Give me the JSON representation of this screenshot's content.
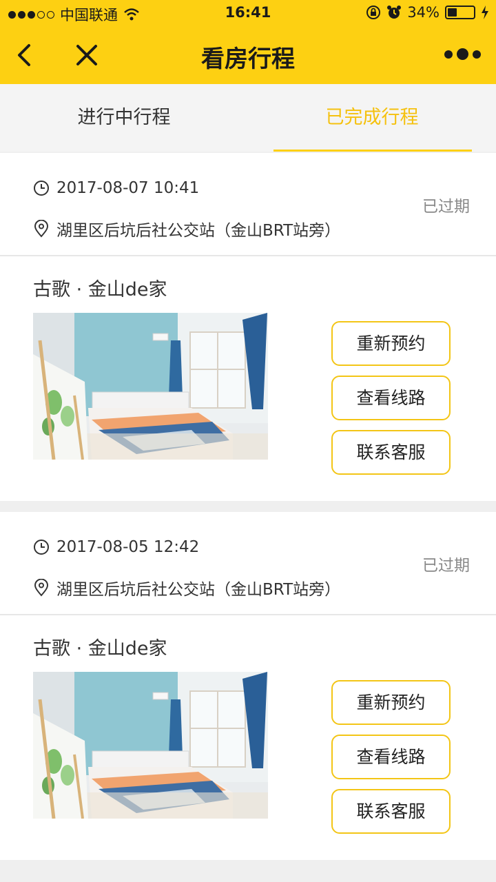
{
  "status_bar": {
    "carrier": "中国联通",
    "time": "16:41",
    "battery": "34%",
    "battery_level": 0.34
  },
  "nav": {
    "title": "看房行程",
    "back_icon": "chevron-left-icon",
    "close_icon": "close-icon",
    "more_icon": "more-icon"
  },
  "tabs": [
    {
      "label": "进行中行程",
      "active": false
    },
    {
      "label": "已完成行程",
      "active": true
    }
  ],
  "trips": [
    {
      "datetime": "2017-08-07 10:41",
      "location": "湖里区后坑后社公交站（金山BRT站旁）",
      "status": "已过期",
      "house_name": "古歌 · 金山de家",
      "buttons": [
        "重新预约",
        "查看线路",
        "联系客服"
      ]
    },
    {
      "datetime": "2017-08-05 12:42",
      "location": "湖里区后坑后社公交站（金山BRT站旁）",
      "status": "已过期",
      "house_name": "古歌 · 金山de家",
      "buttons": [
        "重新预约",
        "查看线路",
        "联系客服"
      ]
    }
  ],
  "colors": {
    "accent": "#fdd012",
    "active_tab": "#f5c10e",
    "button_border": "#f3c515",
    "muted": "#888888"
  }
}
